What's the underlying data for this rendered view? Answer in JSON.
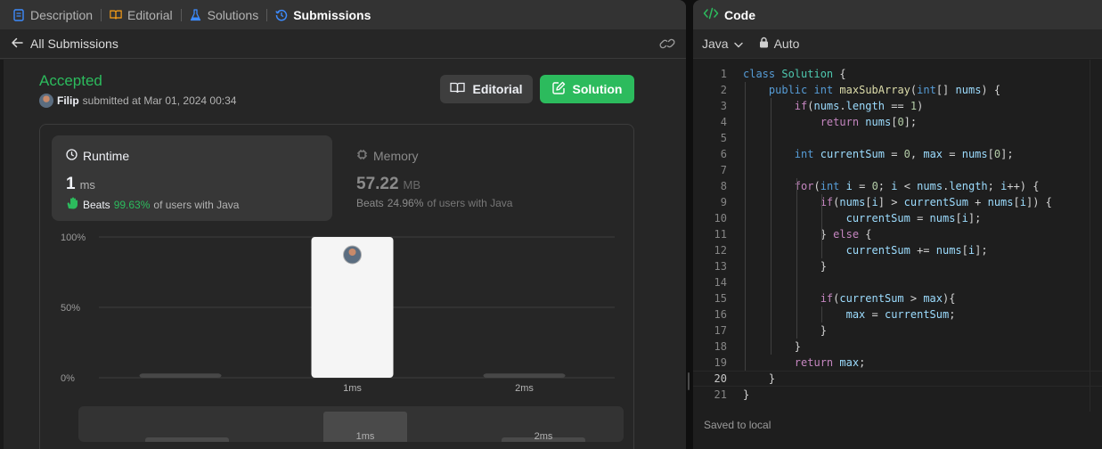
{
  "tabs": [
    {
      "label": "Description",
      "icon": "document-icon",
      "active": false
    },
    {
      "label": "Editorial",
      "icon": "book-icon",
      "active": false
    },
    {
      "label": "Solutions",
      "icon": "flask-icon",
      "active": false
    },
    {
      "label": "Submissions",
      "icon": "history-icon",
      "active": true
    }
  ],
  "subheader": {
    "back_label": "All Submissions"
  },
  "submission": {
    "status": "Accepted",
    "user": "Filip",
    "submitted_text": "submitted at Mar 01, 2024 00:34"
  },
  "buttons": {
    "editorial": "Editorial",
    "solution": "Solution"
  },
  "runtime": {
    "title": "Runtime",
    "value": "1",
    "unit": "ms",
    "beats_label": "Beats",
    "beats_pct": "99.63%",
    "beats_suffix": "of users with Java"
  },
  "memory": {
    "title": "Memory",
    "value": "57.22",
    "unit": "MB",
    "beats_label": "Beats",
    "beats_pct": "24.96%",
    "beats_suffix": "of users with Java"
  },
  "chart_data": {
    "type": "bar",
    "categories": [
      "",
      "1ms",
      "2ms"
    ],
    "values": [
      1,
      100,
      1
    ],
    "y_ticks": [
      "100%",
      "50%",
      "0%"
    ],
    "ylim": [
      0,
      100
    ],
    "highlight": "1ms",
    "colors": {
      "highlight": "#f5f5f5",
      "normal": "#474747",
      "grid": "#3e3e3e"
    }
  },
  "overview_data": {
    "type": "bar",
    "categories": [
      "",
      "1ms",
      "2ms"
    ],
    "values": [
      1,
      100,
      1
    ],
    "highlight": "1ms"
  },
  "code": {
    "title": "Code",
    "language": "Java",
    "mode": "Auto",
    "saved_text": "Saved to local",
    "current_line": 20,
    "lines": [
      "class Solution {",
      "    public int maxSubArray(int[] nums) {",
      "        if(nums.length == 1)",
      "            return nums[0];",
      "",
      "        int currentSum = 0, max = nums[0];",
      "",
      "        for(int i = 0; i < nums.length; i++) {",
      "            if(nums[i] > currentSum + nums[i]) {",
      "                currentSum = nums[i];",
      "            } else {",
      "                currentSum += nums[i];",
      "            }",
      "",
      "            if(currentSum > max){",
      "                max = currentSum;",
      "            }",
      "        }",
      "        return max;",
      "    }",
      "}"
    ]
  },
  "colors": {
    "accent_green": "#2cbb5d",
    "panel": "#262626",
    "editor": "#1e1e1e"
  }
}
